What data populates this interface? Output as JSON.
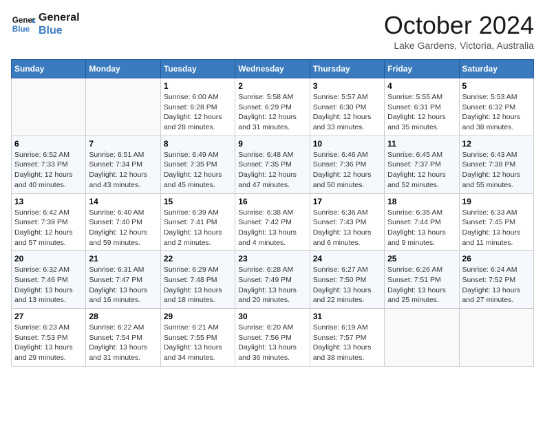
{
  "logo": {
    "line1": "General",
    "line2": "Blue"
  },
  "title": "October 2024",
  "location": "Lake Gardens, Victoria, Australia",
  "headers": [
    "Sunday",
    "Monday",
    "Tuesday",
    "Wednesday",
    "Thursday",
    "Friday",
    "Saturday"
  ],
  "weeks": [
    [
      {
        "day": "",
        "info": ""
      },
      {
        "day": "",
        "info": ""
      },
      {
        "day": "1",
        "info": "Sunrise: 6:00 AM\nSunset: 6:28 PM\nDaylight: 12 hours\nand 28 minutes."
      },
      {
        "day": "2",
        "info": "Sunrise: 5:58 AM\nSunset: 6:29 PM\nDaylight: 12 hours\nand 31 minutes."
      },
      {
        "day": "3",
        "info": "Sunrise: 5:57 AM\nSunset: 6:30 PM\nDaylight: 12 hours\nand 33 minutes."
      },
      {
        "day": "4",
        "info": "Sunrise: 5:55 AM\nSunset: 6:31 PM\nDaylight: 12 hours\nand 35 minutes."
      },
      {
        "day": "5",
        "info": "Sunrise: 5:53 AM\nSunset: 6:32 PM\nDaylight: 12 hours\nand 38 minutes."
      }
    ],
    [
      {
        "day": "6",
        "info": "Sunrise: 6:52 AM\nSunset: 7:33 PM\nDaylight: 12 hours\nand 40 minutes."
      },
      {
        "day": "7",
        "info": "Sunrise: 6:51 AM\nSunset: 7:34 PM\nDaylight: 12 hours\nand 43 minutes."
      },
      {
        "day": "8",
        "info": "Sunrise: 6:49 AM\nSunset: 7:35 PM\nDaylight: 12 hours\nand 45 minutes."
      },
      {
        "day": "9",
        "info": "Sunrise: 6:48 AM\nSunset: 7:35 PM\nDaylight: 12 hours\nand 47 minutes."
      },
      {
        "day": "10",
        "info": "Sunrise: 6:46 AM\nSunset: 7:36 PM\nDaylight: 12 hours\nand 50 minutes."
      },
      {
        "day": "11",
        "info": "Sunrise: 6:45 AM\nSunset: 7:37 PM\nDaylight: 12 hours\nand 52 minutes."
      },
      {
        "day": "12",
        "info": "Sunrise: 6:43 AM\nSunset: 7:38 PM\nDaylight: 12 hours\nand 55 minutes."
      }
    ],
    [
      {
        "day": "13",
        "info": "Sunrise: 6:42 AM\nSunset: 7:39 PM\nDaylight: 12 hours\nand 57 minutes."
      },
      {
        "day": "14",
        "info": "Sunrise: 6:40 AM\nSunset: 7:40 PM\nDaylight: 12 hours\nand 59 minutes."
      },
      {
        "day": "15",
        "info": "Sunrise: 6:39 AM\nSunset: 7:41 PM\nDaylight: 13 hours\nand 2 minutes."
      },
      {
        "day": "16",
        "info": "Sunrise: 6:38 AM\nSunset: 7:42 PM\nDaylight: 13 hours\nand 4 minutes."
      },
      {
        "day": "17",
        "info": "Sunrise: 6:36 AM\nSunset: 7:43 PM\nDaylight: 13 hours\nand 6 minutes."
      },
      {
        "day": "18",
        "info": "Sunrise: 6:35 AM\nSunset: 7:44 PM\nDaylight: 13 hours\nand 9 minutes."
      },
      {
        "day": "19",
        "info": "Sunrise: 6:33 AM\nSunset: 7:45 PM\nDaylight: 13 hours\nand 11 minutes."
      }
    ],
    [
      {
        "day": "20",
        "info": "Sunrise: 6:32 AM\nSunset: 7:46 PM\nDaylight: 13 hours\nand 13 minutes."
      },
      {
        "day": "21",
        "info": "Sunrise: 6:31 AM\nSunset: 7:47 PM\nDaylight: 13 hours\nand 16 minutes."
      },
      {
        "day": "22",
        "info": "Sunrise: 6:29 AM\nSunset: 7:48 PM\nDaylight: 13 hours\nand 18 minutes."
      },
      {
        "day": "23",
        "info": "Sunrise: 6:28 AM\nSunset: 7:49 PM\nDaylight: 13 hours\nand 20 minutes."
      },
      {
        "day": "24",
        "info": "Sunrise: 6:27 AM\nSunset: 7:50 PM\nDaylight: 13 hours\nand 22 minutes."
      },
      {
        "day": "25",
        "info": "Sunrise: 6:26 AM\nSunset: 7:51 PM\nDaylight: 13 hours\nand 25 minutes."
      },
      {
        "day": "26",
        "info": "Sunrise: 6:24 AM\nSunset: 7:52 PM\nDaylight: 13 hours\nand 27 minutes."
      }
    ],
    [
      {
        "day": "27",
        "info": "Sunrise: 6:23 AM\nSunset: 7:53 PM\nDaylight: 13 hours\nand 29 minutes."
      },
      {
        "day": "28",
        "info": "Sunrise: 6:22 AM\nSunset: 7:54 PM\nDaylight: 13 hours\nand 31 minutes."
      },
      {
        "day": "29",
        "info": "Sunrise: 6:21 AM\nSunset: 7:55 PM\nDaylight: 13 hours\nand 34 minutes."
      },
      {
        "day": "30",
        "info": "Sunrise: 6:20 AM\nSunset: 7:56 PM\nDaylight: 13 hours\nand 36 minutes."
      },
      {
        "day": "31",
        "info": "Sunrise: 6:19 AM\nSunset: 7:57 PM\nDaylight: 13 hours\nand 38 minutes."
      },
      {
        "day": "",
        "info": ""
      },
      {
        "day": "",
        "info": ""
      }
    ]
  ]
}
